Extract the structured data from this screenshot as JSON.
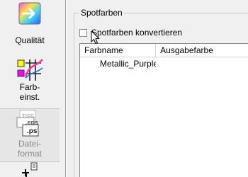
{
  "sidebar": {
    "items": [
      {
        "label_lines": [
          "Qualität"
        ],
        "icon": "quality-icon",
        "state": "normal"
      },
      {
        "label_lines": [
          "Farb-",
          "einst."
        ],
        "icon": "color-settings-icon",
        "state": "normal"
      },
      {
        "label_lines": [
          "Datei-",
          "format"
        ],
        "icon": "file-format-icon",
        "state": "disabled",
        "icon_text": [
          "TIFF",
          ".eps",
          ".ps"
        ]
      },
      {
        "label_lines": [],
        "icon": "layout-icon",
        "state": "normal"
      }
    ]
  },
  "group": {
    "title": "Spotfarben",
    "checkbox": {
      "label": "Spotfarben konvertieren",
      "checked": false
    },
    "table": {
      "columns": [
        "Farbname",
        "Ausgabefarbe"
      ],
      "rows": [
        {
          "name": "Metallic_Purple",
          "output": ""
        }
      ]
    }
  },
  "colors": {
    "background": "#f0f0f0",
    "list_background": "#ffffff",
    "border": "#828790"
  }
}
